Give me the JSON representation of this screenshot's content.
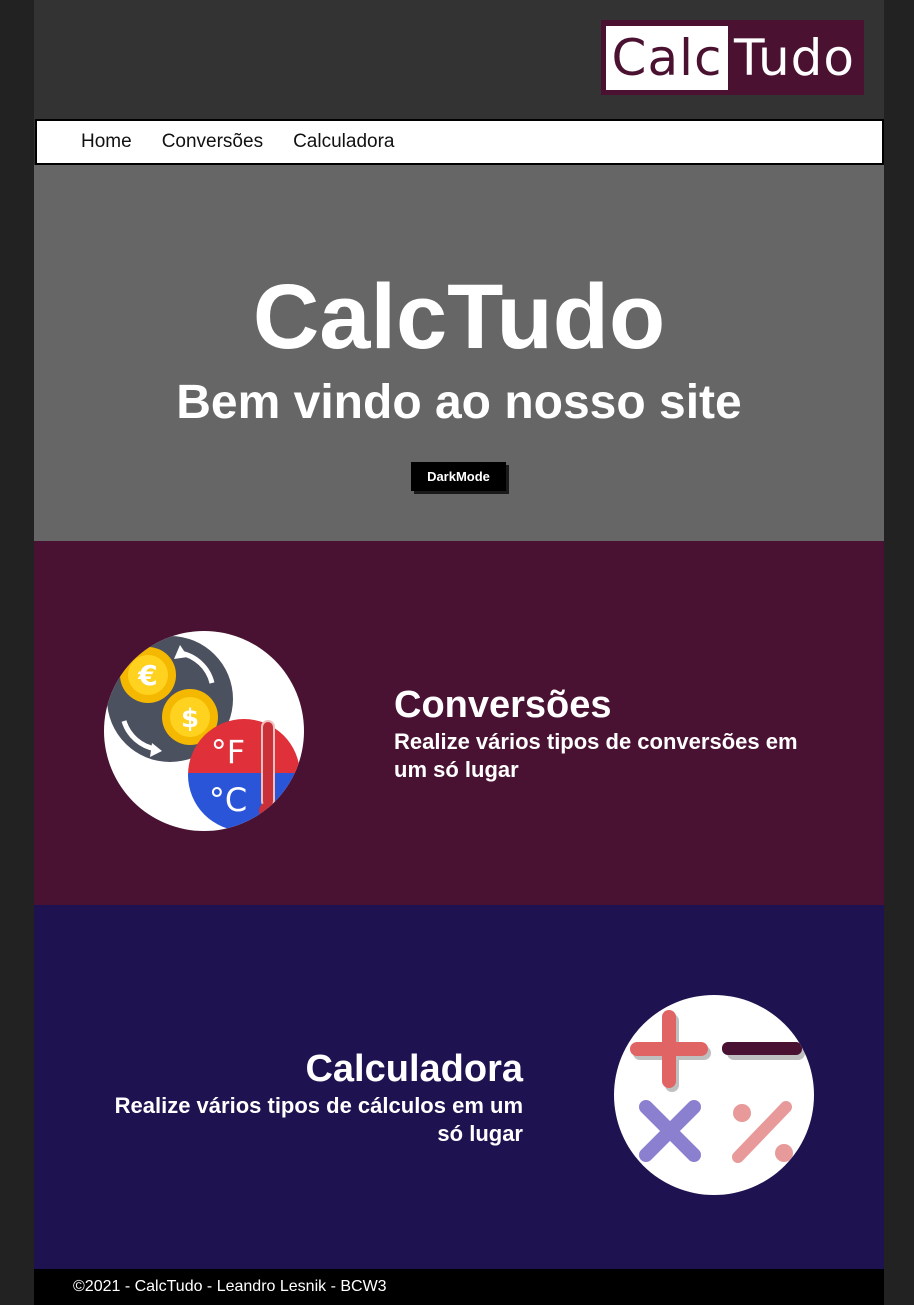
{
  "header": {
    "logo_part_a": "Calc",
    "logo_part_b": "Tudo"
  },
  "nav": {
    "items": [
      {
        "label": "Home"
      },
      {
        "label": "Conversões"
      },
      {
        "label": "Calculadora"
      }
    ]
  },
  "hero": {
    "title": "CalcTudo",
    "subtitle": "Bem vindo ao nosso site",
    "button_label": "DarkMode"
  },
  "sections": {
    "conversions": {
      "title": "Conversões",
      "description": "Realize vários tipos de conversões em um só lugar",
      "icon": "currency-temperature-icon"
    },
    "calculator": {
      "title": "Calculadora",
      "description": "Realize vários tipos de cálculos em um só lugar",
      "icon": "math-operators-icon"
    }
  },
  "footer": {
    "text": "©2021 - CalcTudo - Leandro Lesnik - BCW3"
  },
  "colors": {
    "page_bg": "#222222",
    "header_bg": "#333333",
    "logo_bg": "#4a1230",
    "hero_bg": "#666666",
    "conversions_bg": "#4a1232",
    "calculator_bg": "#1f1250",
    "footer_bg": "#000000"
  }
}
